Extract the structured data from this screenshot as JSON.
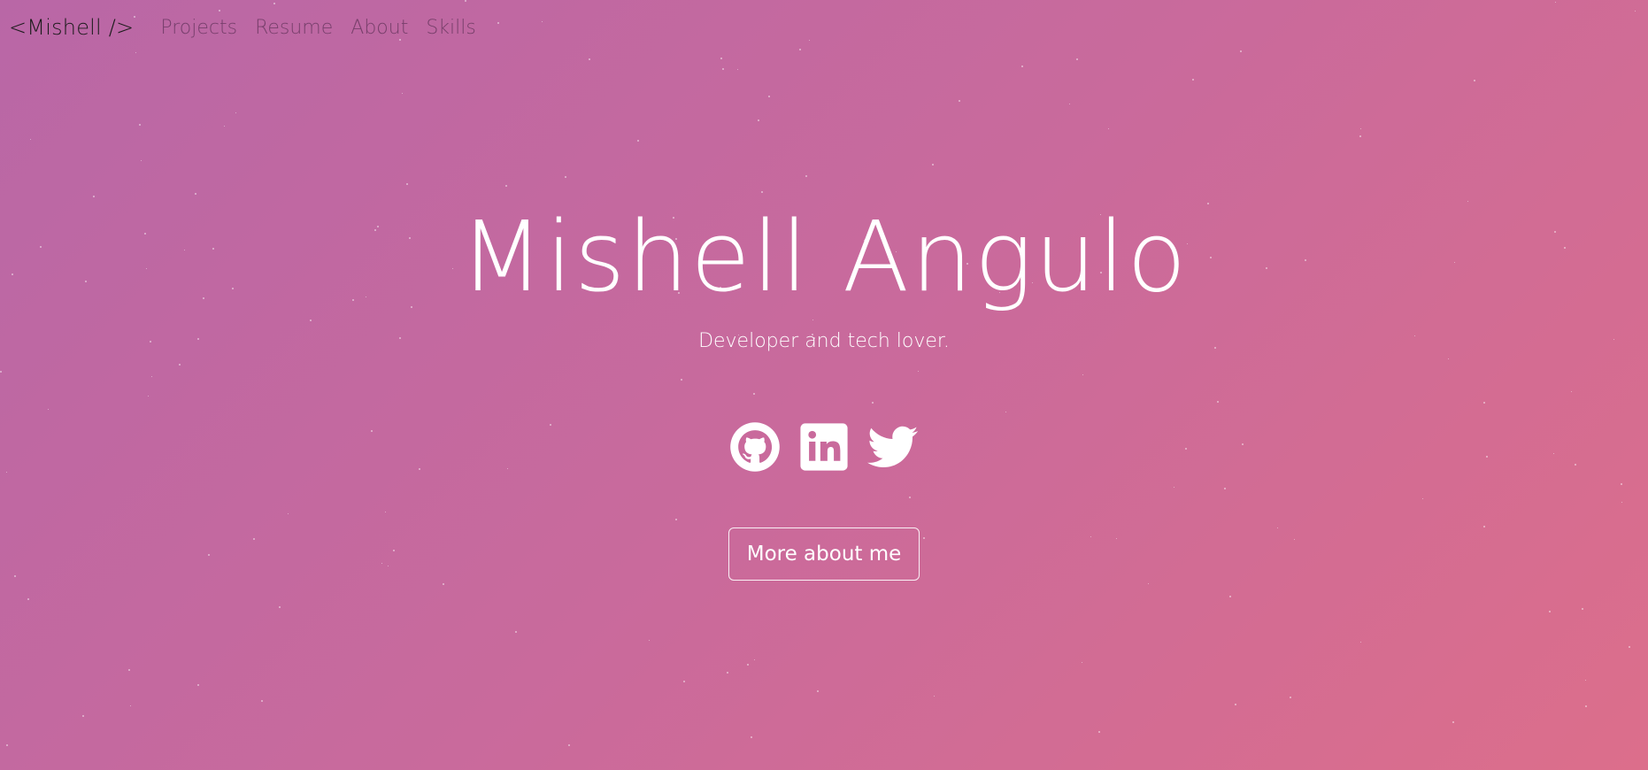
{
  "colors": {
    "gradient_start": "#b967a6",
    "gradient_mid": "#c96a9c",
    "gradient_end": "#dc6e8b",
    "brand_text": "#1b1b1b",
    "text": "#ffffff"
  },
  "navbar": {
    "brand": "<Mishell />",
    "links": [
      "Projects",
      "Resume",
      "About",
      "Skills"
    ]
  },
  "hero": {
    "title": "Mishell Angulo",
    "subtitle": "Developer and tech lover.",
    "socials": [
      {
        "icon": "github-icon"
      },
      {
        "icon": "linkedin-icon"
      },
      {
        "icon": "twitter-icon"
      }
    ],
    "cta_label": "More about me"
  }
}
